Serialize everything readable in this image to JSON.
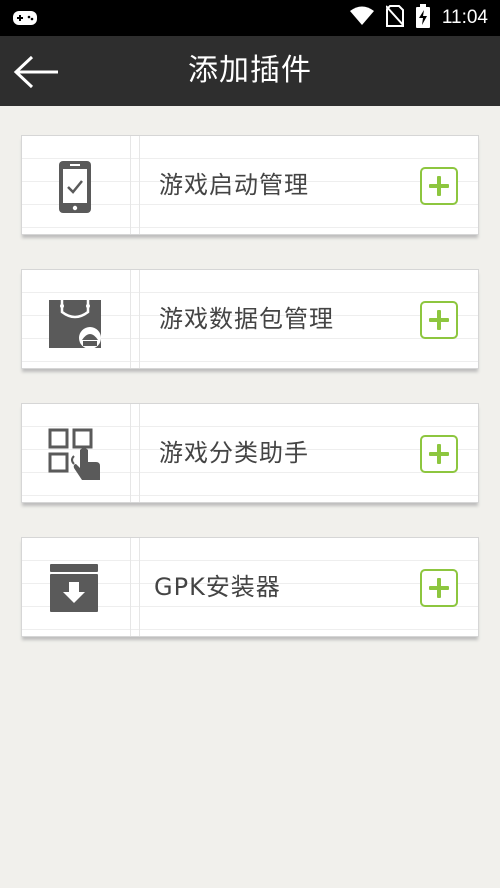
{
  "status_bar": {
    "time": "11:04",
    "icons": [
      "gamepad-icon",
      "wifi-icon",
      "no-sim-icon",
      "battery-charging-icon"
    ]
  },
  "app_bar": {
    "title": "添加插件",
    "back_icon": "arrow-left-icon"
  },
  "plugins": [
    {
      "label": "游戏启动管理",
      "icon": "phone-check-icon",
      "action_icon": "add-icon"
    },
    {
      "label": "游戏数据包管理",
      "icon": "shopping-bag-android-icon",
      "action_icon": "add-icon"
    },
    {
      "label": "游戏分类助手",
      "icon": "grid-hand-icon",
      "action_icon": "add-icon"
    },
    {
      "label": "GPK安装器",
      "icon": "download-box-icon",
      "action_icon": "add-icon"
    }
  ],
  "colors": {
    "accent": "#8dc63f",
    "app_bar": "#2e2e2e",
    "background": "#f1f0ec",
    "icon": "#5a5a5a"
  }
}
